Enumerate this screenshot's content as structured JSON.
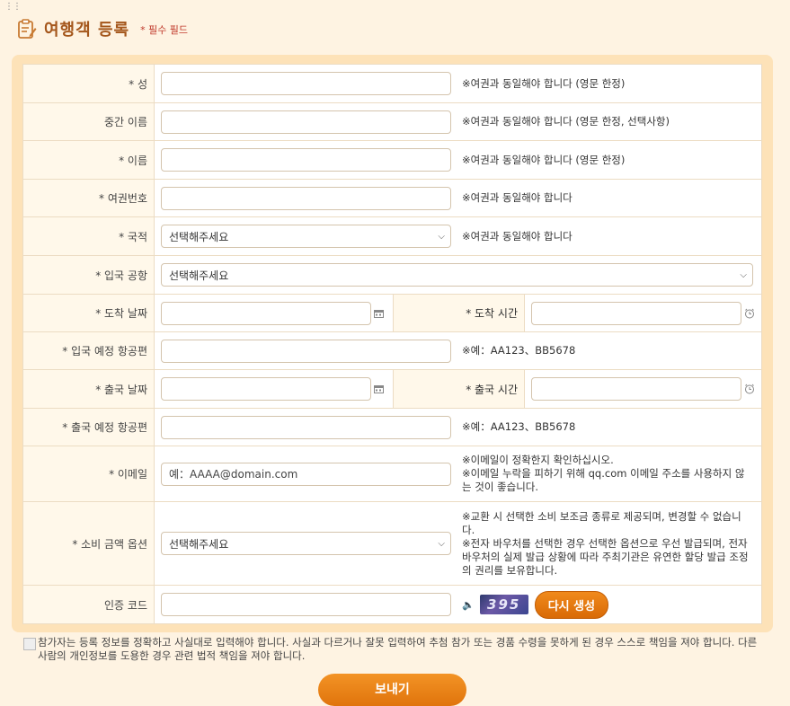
{
  "header": {
    "title": "여행객 등록",
    "required_note": "* 필수 필드"
  },
  "fields": {
    "last_name": {
      "label": "* 성",
      "note": "※여권과 동일해야 합니다 (영문 한정)"
    },
    "middle_name": {
      "label": "중간 이름",
      "note": "※여권과 동일해야 합니다 (영문 한정, 선택사항)"
    },
    "first_name": {
      "label": "* 이름",
      "note": "※여권과 동일해야 합니다 (영문 한정)"
    },
    "passport": {
      "label": "* 여권번호",
      "note": "※여권과 동일해야 합니다"
    },
    "nationality": {
      "label": "* 국적",
      "value": "선택해주세요",
      "note": "※여권과 동일해야 합니다"
    },
    "airport": {
      "label": "* 입국 공항",
      "value": "선택해주세요"
    },
    "arrival_date": {
      "label": "* 도착 날짜"
    },
    "arrival_time": {
      "label": "* 도착 시간"
    },
    "arrival_flight": {
      "label": "* 입국 예정 항공편",
      "note": "※예：AA123、BB5678"
    },
    "departure_date": {
      "label": "* 출국 날짜"
    },
    "departure_time": {
      "label": "* 출국 시간"
    },
    "departure_flight": {
      "label": "* 출국 예정 항공편",
      "note": "※예：AA123、BB5678"
    },
    "email": {
      "label": "* 이메일",
      "placeholder": "예：AAAA@domain.com",
      "note_1": "※이메일이 정확한지 확인하십시오.",
      "note_2": "※이메일 누락을 피하기 위해 qq.com 이메일 주소를 사용하지 않는 것이 좋습니다."
    },
    "spending": {
      "label": "* 소비 금액 옵션",
      "value": "선택해주세요",
      "note_1": "※교환 시 선택한 소비 보조금 종류로 제공되며, 변경할 수 없습니다.",
      "note_2": "※전자 바우처를 선택한 경우 선택한 옵션으로 우선 발급되며, 전자 바우처의 실제 발급 상황에 따라 주최기관은 유연한 할당 발급 조정의 권리를 보유합니다."
    },
    "captcha": {
      "label": "인증 코드",
      "image_text": "395",
      "regen_label": "다시 생성"
    }
  },
  "agreement": "참가자는 등록 정보를 정확하고 사실대로 입력해야 합니다. 사실과 다르거나 잘못 입력하여 추첨 참가 또는 경품 수령을 못하게 된 경우 스스로 책임을 져야 합니다. 다른 사람의 개인정보를 도용한 경우 관련 법적 책임을 져야 합니다.",
  "submit_label": "보내기",
  "colors": {
    "accent": "#e0740c",
    "title": "#a4561b",
    "panel": "#fde2b8",
    "label_bg": "#fff8ea"
  }
}
